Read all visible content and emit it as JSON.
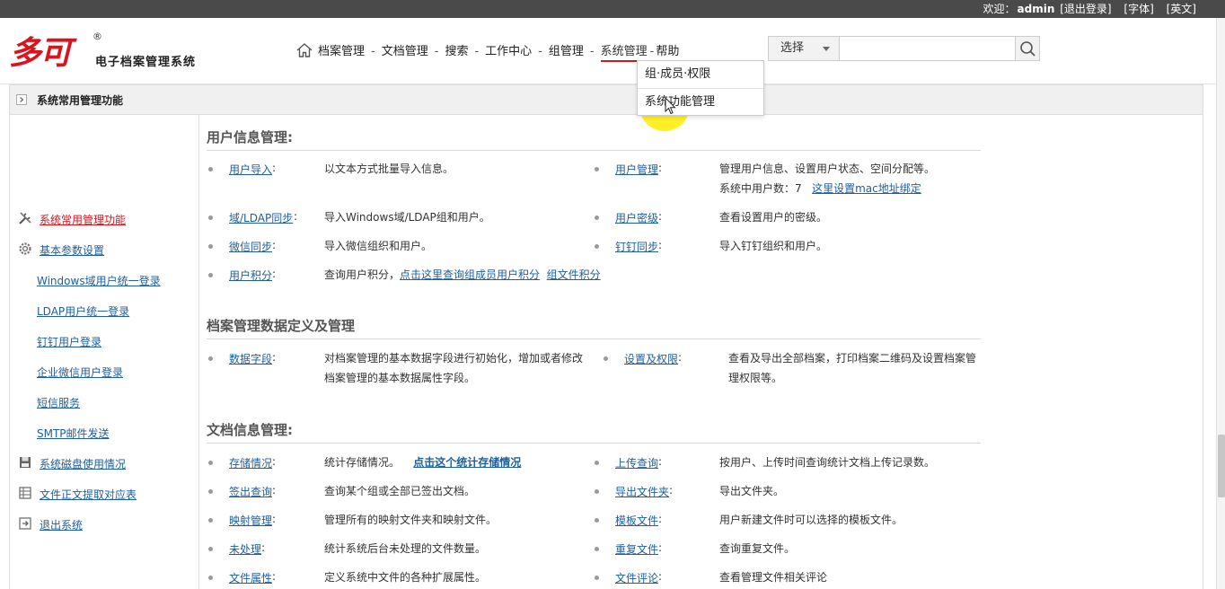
{
  "topbar": {
    "welcome": "欢迎：",
    "username": "admin",
    "logout": "[退出登录]",
    "font": "[字体]",
    "english": "[英文]"
  },
  "logo": {
    "mark": "多可",
    "registered": "®",
    "system_name": "电子档案管理系统"
  },
  "nav": {
    "items": [
      "档案管理",
      "文档管理",
      "搜索",
      "工作中心",
      "组管理",
      "系统管理",
      "帮助"
    ]
  },
  "search": {
    "select_label": "选择",
    "input_value": ""
  },
  "dropdown": {
    "options": [
      "组·成员·权限",
      "系统功能管理"
    ]
  },
  "panel": {
    "title": "系统常用管理功能"
  },
  "sidebar": {
    "items": [
      {
        "label": "系统常用管理功能"
      },
      {
        "label": "基本参数设置"
      },
      {
        "label": "Windows域用户统一登录"
      },
      {
        "label": "LDAP用户统一登录"
      },
      {
        "label": "钉钉用户登录"
      },
      {
        "label": "企业微信用户登录"
      },
      {
        "label": "短信服务"
      },
      {
        "label": "SMTP邮件发送"
      },
      {
        "label": "系统磁盘使用情况"
      },
      {
        "label": "文件正文提取对应表"
      },
      {
        "label": "退出系统"
      }
    ]
  },
  "sections": {
    "user": {
      "title": "用户信息管理:",
      "rows": [
        {
          "link": "用户导入",
          "desc": "以文本方式批量导入信息。"
        },
        {
          "link": "用户管理",
          "desc": "管理用户信息、设置用户状态、空间分配等。",
          "desc2": "系统中用户数：7",
          "desc2_link": "这里设置mac地址绑定"
        },
        {
          "link": "域/LDAP同步",
          "desc": "导入Windows域/LDAP组和用户。"
        },
        {
          "link": "用户密级",
          "desc": "查看设置用户的密级。"
        },
        {
          "link": "微信同步",
          "desc": "导入微信组织和用户。"
        },
        {
          "link": "钉钉同步",
          "desc": "导入钉钉组织和用户。"
        },
        {
          "link": "用户积分",
          "desc": "查询用户积分，",
          "desc_link1": "点击这里查询组成员用户积分",
          "desc_link2": "组文件积分"
        }
      ]
    },
    "archive": {
      "title": "档案管理数据定义及管理",
      "rows": [
        {
          "link": "数据字段",
          "desc": "对档案管理的基本数据字段进行初始化，增加或者修改档案管理的基本数据属性字段。"
        },
        {
          "link": "设置及权限",
          "desc": "查看及导出全部档案，打印档案二维码及设置档案管理权限等。"
        }
      ]
    },
    "doc": {
      "title": "文档信息管理:",
      "rows": [
        {
          "link": "存储情况",
          "desc": "统计存储情况。",
          "desc_link": "点击这个统计存储情况"
        },
        {
          "link": "上传查询",
          "desc": "按用户、上传时间查询统计文档上传记录数。"
        },
        {
          "link": "签出查询",
          "desc": "查询某个组或全部已签出文档。"
        },
        {
          "link": "导出文件夹",
          "desc": "导出文件夹。"
        },
        {
          "link": "映射管理",
          "desc": "管理所有的映射文件夹和映射文件。"
        },
        {
          "link": "模板文件",
          "desc": "用户新建文件时可以选择的模板文件。"
        },
        {
          "link": "未处理",
          "desc": "统计系统后台未处理的文件数量。"
        },
        {
          "link": "重复文件",
          "desc": "查询重复文件。"
        },
        {
          "link": "文件属性",
          "desc": "定义系统中文件的各种扩展属性。"
        },
        {
          "link": "文件评论",
          "desc": "查看管理文件相关评论"
        }
      ]
    }
  },
  "colors": {
    "accent": "#d9141c",
    "link": "#1f5fa0",
    "topbar": "#4a4a4a",
    "highlight": "#ffec00"
  }
}
